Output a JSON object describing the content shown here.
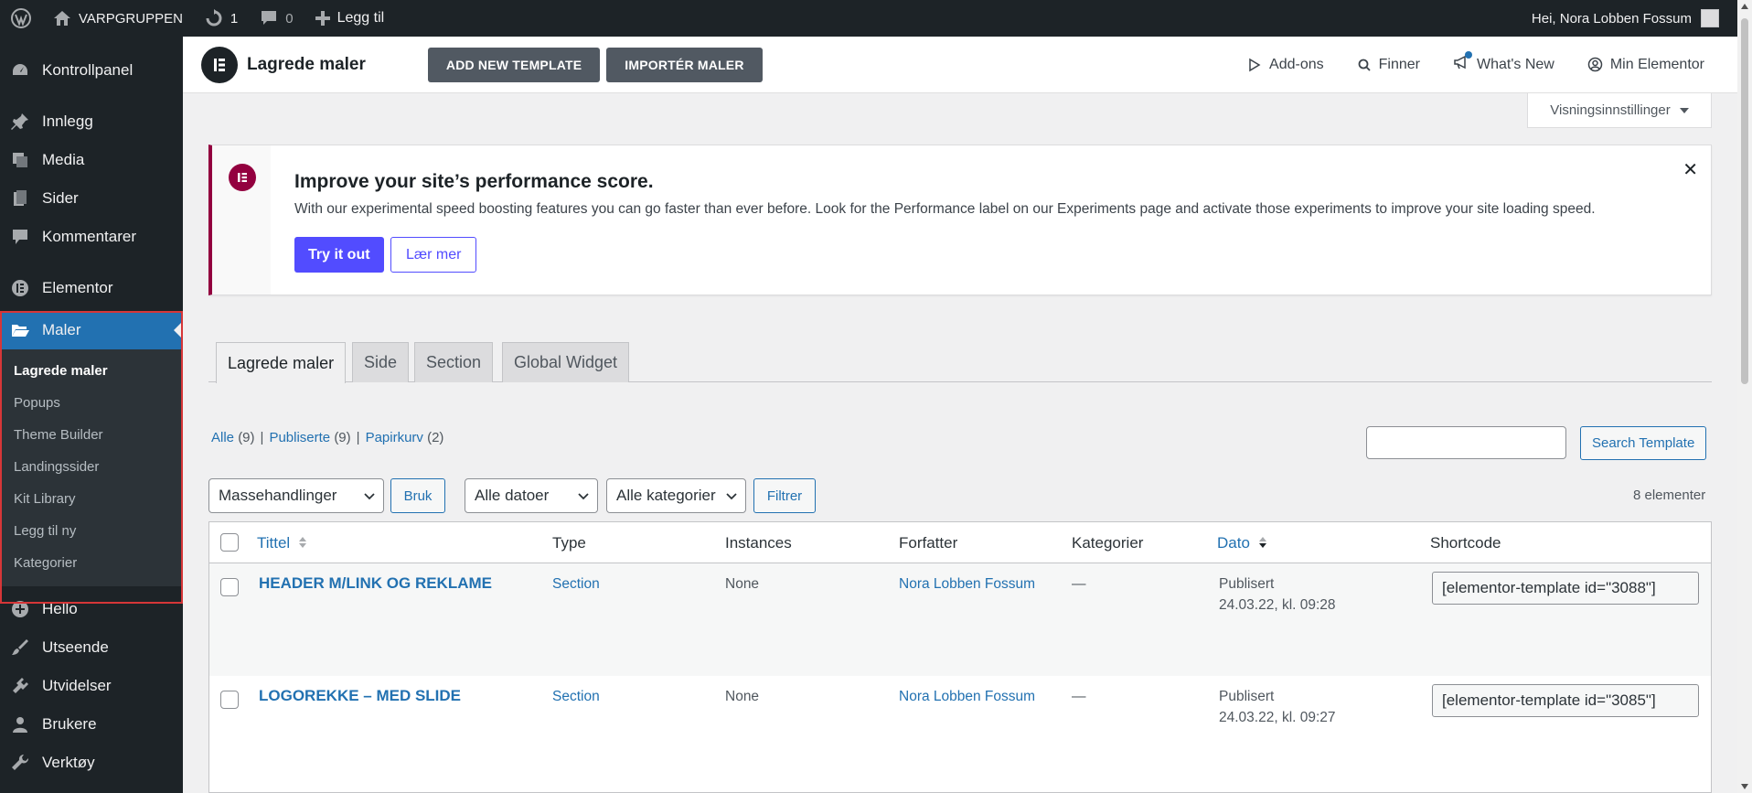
{
  "admin_bar": {
    "site_name": "VARPGRUPPEN",
    "updates_count": "1",
    "comments_count": "0",
    "new_label": "Legg til",
    "greeting": "Hei, Nora Lobben Fossum"
  },
  "sidebar": {
    "items": [
      {
        "label": "Kontrollpanel",
        "icon": "dashboard-icon"
      },
      {
        "label": "Innlegg",
        "icon": "pin-icon"
      },
      {
        "label": "Media",
        "icon": "media-icon"
      },
      {
        "label": "Sider",
        "icon": "pages-icon"
      },
      {
        "label": "Kommentarer",
        "icon": "comment-icon"
      },
      {
        "label": "Elementor",
        "icon": "elementor-icon"
      },
      {
        "label": "Maler",
        "icon": "folder-icon"
      },
      {
        "label": "Hello",
        "icon": "plus-circle-icon"
      },
      {
        "label": "Utseende",
        "icon": "brush-icon"
      },
      {
        "label": "Utvidelser",
        "icon": "plugin-icon"
      },
      {
        "label": "Brukere",
        "icon": "users-icon"
      },
      {
        "label": "Verktøy",
        "icon": "wrench-icon"
      }
    ],
    "submenu": [
      "Lagrede maler",
      "Popups",
      "Theme Builder",
      "Landingssider",
      "Kit Library",
      "Legg til ny",
      "Kategorier"
    ]
  },
  "header": {
    "title": "Lagrede maler",
    "add_new": "ADD NEW TEMPLATE",
    "import": "IMPORTÉR MALER",
    "links": [
      "Add-ons",
      "Finner",
      "What's New",
      "Min Elementor"
    ]
  },
  "screen_options": "Visningsinnstillinger",
  "notice": {
    "title": "Improve your site’s performance score.",
    "text": "With our experimental speed boosting features you can go faster than ever before. Look for the Performance label on our Experiments page and activate those experiments to improve your site loading speed.",
    "primary_btn": "Try it out",
    "secondary_btn": "Lær mer",
    "accent_color": "#93003f",
    "button_color": "#524cff"
  },
  "tabs": [
    "Lagrede maler",
    "Side",
    "Section",
    "Global Widget"
  ],
  "filters": {
    "all": "Alle",
    "all_count": "(9)",
    "published": "Publiserte",
    "published_count": "(9)",
    "trash": "Papirkurv",
    "trash_count": "(2)",
    "search_button": "Search Template"
  },
  "tablenav": {
    "bulk": "Massehandlinger",
    "apply": "Bruk",
    "dates": "Alle datoer",
    "categories": "Alle kategorier",
    "filter": "Filtrer",
    "count": "8 elementer"
  },
  "table": {
    "columns": [
      "Tittel",
      "Type",
      "Instances",
      "Forfatter",
      "Kategorier",
      "Dato",
      "Shortcode"
    ],
    "rows": [
      {
        "title": "HEADER M/LINK OG REKLAME",
        "type": "Section",
        "instances": "None",
        "author": "Nora Lobben Fossum",
        "categories": "—",
        "status": "Publisert",
        "date": "24.03.22, kl. 09:28",
        "shortcode": "[elementor-template id=\"3088\"]"
      },
      {
        "title": "LOGOREKKE – MED SLIDE",
        "type": "Section",
        "instances": "None",
        "author": "Nora Lobben Fossum",
        "categories": "—",
        "status": "Publisert",
        "date": "24.03.22, kl. 09:27",
        "shortcode": "[elementor-template id=\"3085\"]"
      }
    ]
  }
}
